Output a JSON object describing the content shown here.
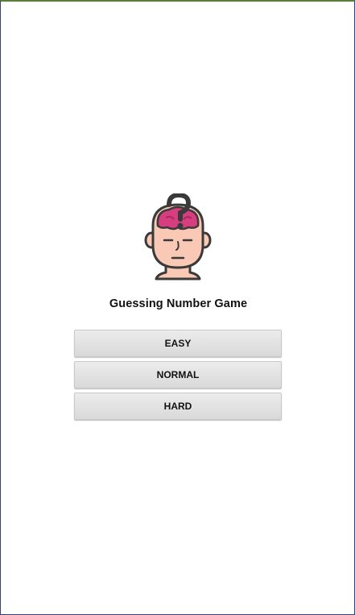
{
  "app": {
    "title": "Guessing Number Game"
  },
  "icon": {
    "name": "thinking-head-question-icon"
  },
  "buttons": {
    "easy": "EASY",
    "normal": "NORMAL",
    "hard": "HARD"
  },
  "colors": {
    "brain": "#d63e7f",
    "skin": "#f9c9b6",
    "outline": "#3a3a3a",
    "button_bg": "#e0e0e0"
  }
}
